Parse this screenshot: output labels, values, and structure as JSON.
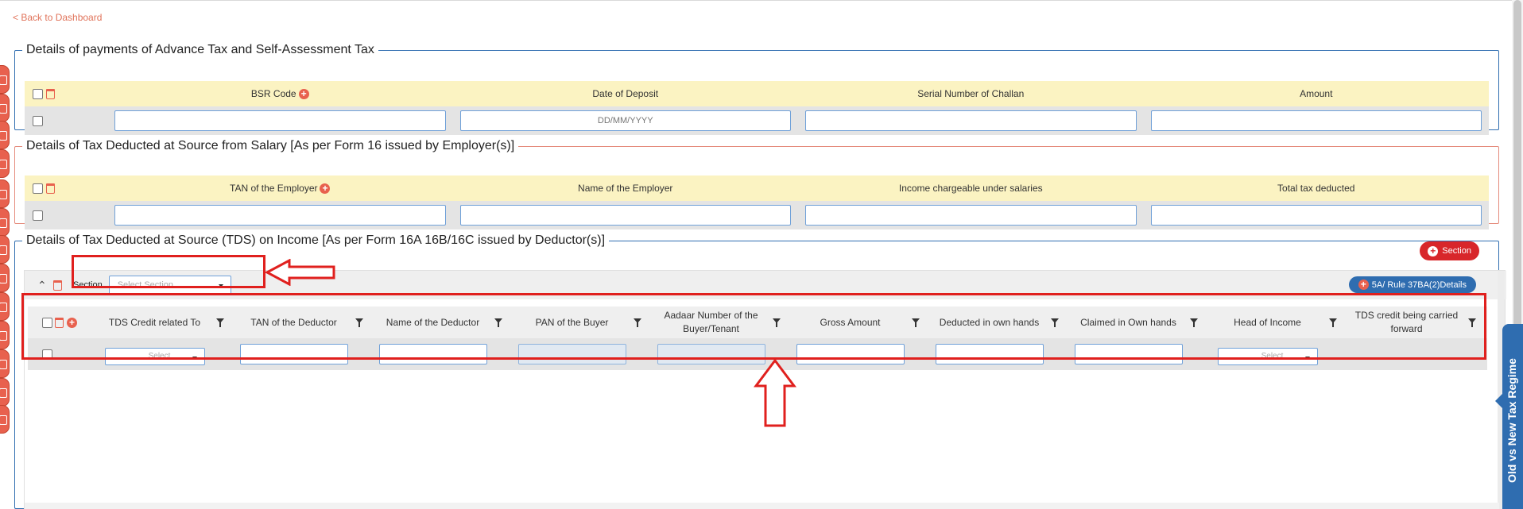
{
  "nav": {
    "back_label": "< Back to Dashboard"
  },
  "advance_tax": {
    "title": "Details of payments of Advance Tax and Self-Assessment Tax",
    "columns": [
      "BSR Code",
      "Date of Deposit",
      "Serial Number of Challan",
      "Amount"
    ],
    "date_placeholder": "DD/MM/YYYY"
  },
  "salary_tds": {
    "title": "Details of Tax Deducted at Source from Salary [As per Form 16 issued by Employer(s)]",
    "columns": [
      "TAN of the Employer",
      "Name of the Employer",
      "Income chargeable under salaries",
      "Total tax deducted"
    ]
  },
  "income_tds": {
    "title": "Details of Tax Deducted at Source (TDS) on Income [As per Form 16A 16B/16C issued by Deductor(s)]",
    "add_section_label": "Section",
    "section_label": "Section",
    "section_placeholder": "Select Section",
    "rule_button_label": "5A/ Rule 37BA(2)Details",
    "columns": [
      "TDS Credit related To",
      "TAN of the Deductor",
      "Name of the Deductor",
      "PAN of the Buyer",
      "Aadaar Number of the Buyer/Tenant",
      "Gross Amount",
      "Deducted in own hands",
      "Claimed in Own hands",
      "Head of Income",
      "TDS credit being carried forward"
    ],
    "select_placeholder": "Select",
    "head_select_placeholder": "Select"
  },
  "side_tab": {
    "label": "Old vs New Tax Regime"
  },
  "colors": {
    "accent": "#2f6db0",
    "danger": "#e8614e",
    "highlight": "#e0201e",
    "header_bg": "#fbf3c2"
  },
  "icons": [
    "checkbox-icon",
    "trash-icon",
    "plus-icon",
    "filter-icon",
    "chevron-up-icon",
    "dropdown-caret-icon",
    "arrow-left-icon",
    "arrow-up-icon"
  ]
}
